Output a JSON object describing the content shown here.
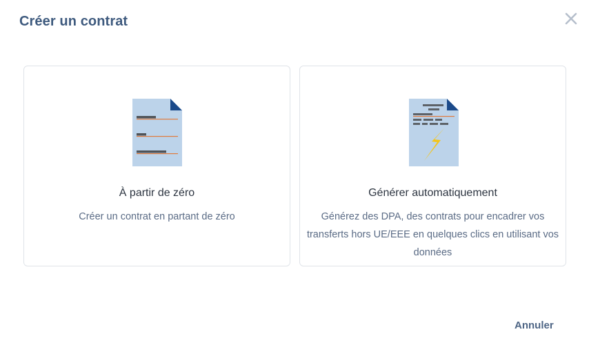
{
  "dialog": {
    "title": "Créer un contrat",
    "close_icon": "close-icon",
    "options": [
      {
        "icon": "blank-document-icon",
        "title": "À partir de zéro",
        "description": "Créer un contrat en partant de zéro"
      },
      {
        "icon": "lightning-document-icon",
        "title": "Générer automatiquement",
        "description": "Générez des DPA, des contrats pour encadrer vos transferts hors UE/EEE en quelques clics en utilisant vos données"
      }
    ],
    "cancel_label": "Annuler"
  },
  "colors": {
    "title": "#3e5a7e",
    "card_border": "#dfe3e8",
    "doc_body": "#bcd3ea",
    "doc_fold": "#1b4a8a",
    "doc_accent_line": "#e07a3c",
    "lightning": "#f5c518"
  }
}
